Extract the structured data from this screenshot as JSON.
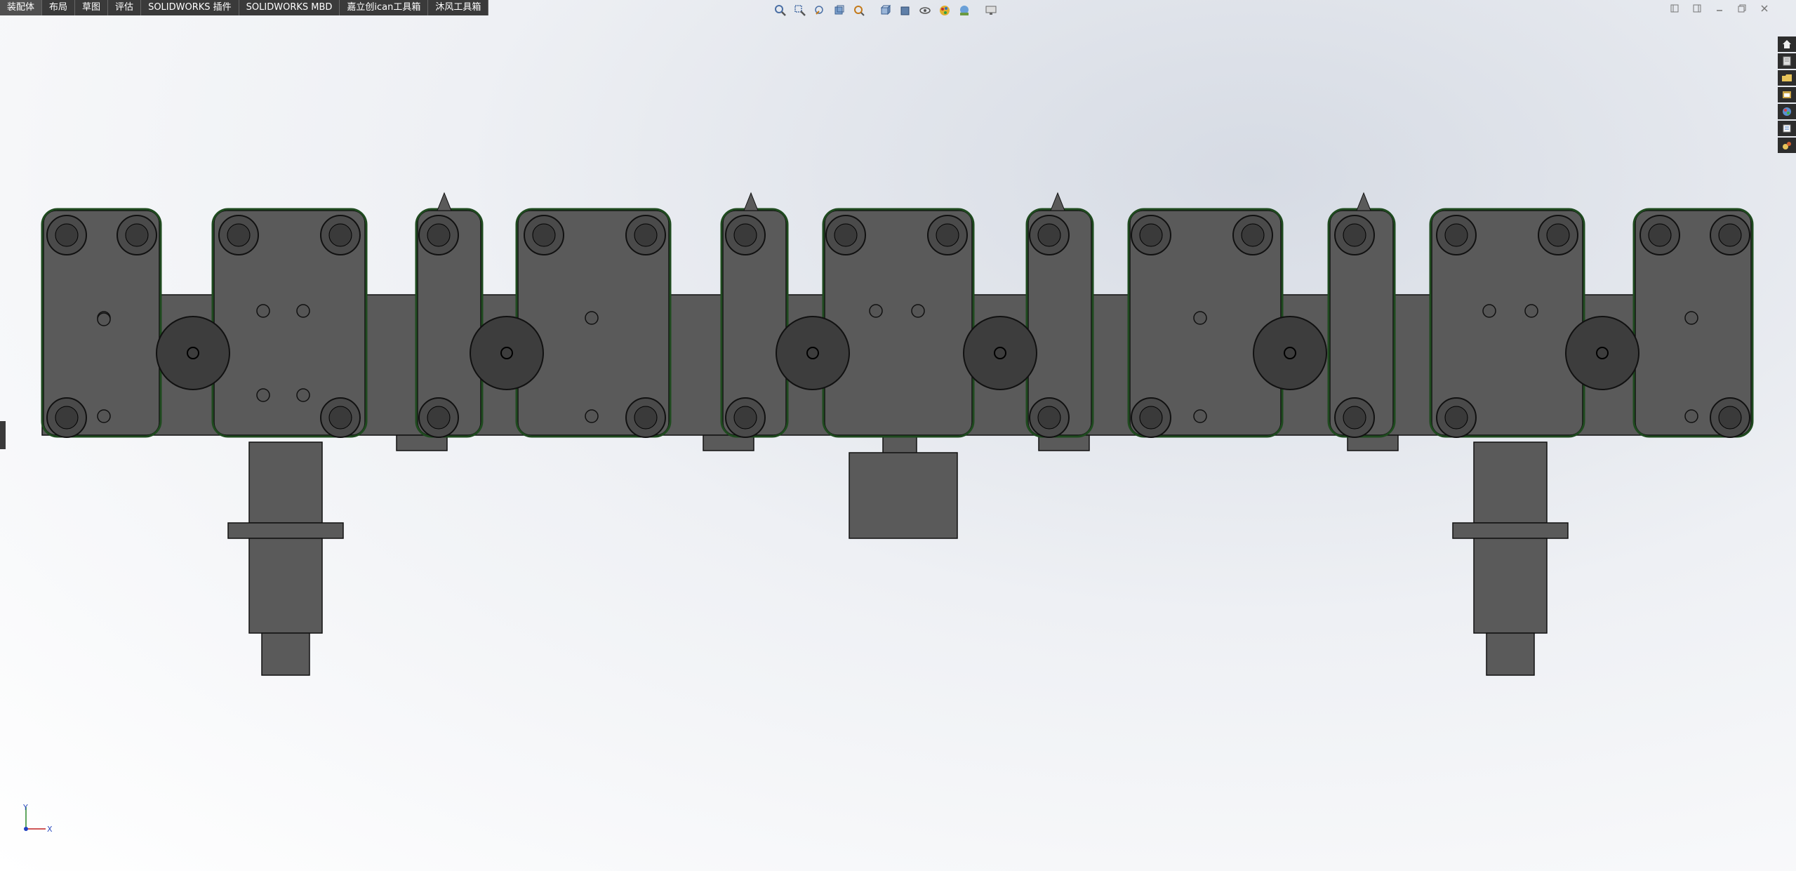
{
  "tabs": [
    {
      "label": "装配体"
    },
    {
      "label": "布局"
    },
    {
      "label": "草图"
    },
    {
      "label": "评估"
    },
    {
      "label": "SOLIDWORKS 插件"
    },
    {
      "label": "SOLIDWORKS MBD"
    },
    {
      "label": "嘉立创ican工具箱"
    },
    {
      "label": "沐风工具箱"
    }
  ],
  "heads_up_toolbar": [
    {
      "icon": "zoom-to-fit-icon"
    },
    {
      "icon": "zoom-to-area-icon"
    },
    {
      "icon": "previous-view-icon"
    },
    {
      "icon": "section-view-icon"
    },
    {
      "icon": "dynamic-annotation-icon"
    },
    {
      "icon": "view-orientation-icon"
    },
    {
      "icon": "display-style-icon"
    },
    {
      "icon": "hide-show-items-icon"
    },
    {
      "icon": "edit-appearance-icon"
    },
    {
      "icon": "apply-scene-icon"
    },
    {
      "icon": "view-settings-icon"
    }
  ],
  "task_pane": [
    {
      "icon": "home-icon"
    },
    {
      "icon": "resources-icon"
    },
    {
      "icon": "design-library-icon"
    },
    {
      "icon": "file-explorer-icon"
    },
    {
      "icon": "view-palette-icon"
    },
    {
      "icon": "appearances-icon"
    },
    {
      "icon": "custom-properties-icon"
    }
  ],
  "triad": {
    "y_label": "Y",
    "x_label": "X"
  },
  "colors": {
    "part": "#5a5a5a",
    "edge": "#111111",
    "belt": "#1f4a1f",
    "tab_bg": "#3a3a3a"
  }
}
